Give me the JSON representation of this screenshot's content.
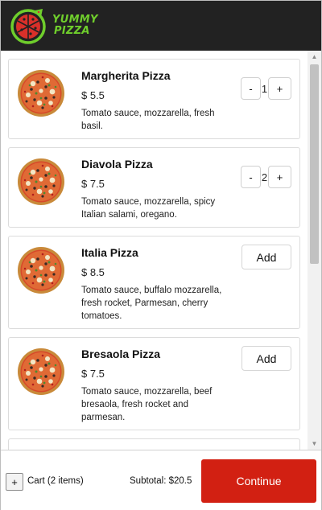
{
  "brand": {
    "line1": "YUMMY",
    "line2": "PIZZA",
    "accent": "#6fce2c",
    "header_bg": "#222222"
  },
  "pizzas": [
    {
      "name": "Margherita Pizza",
      "price": "$ 5.5",
      "description": "Tomato sauce, mozzarella, fresh basil.",
      "quantity": "1",
      "in_cart": true
    },
    {
      "name": "Diavola Pizza",
      "price": "$ 7.5",
      "description": "Tomato sauce, mozzarella, spicy Italian salami, oregano.",
      "quantity": "2",
      "in_cart": true
    },
    {
      "name": "Italia Pizza",
      "price": "$ 8.5",
      "description": "Tomato sauce, buffalo mozzarella, fresh rocket, Parmesan, cherry tomatoes.",
      "add_label": "Add",
      "in_cart": false
    },
    {
      "name": "Bresaola Pizza",
      "price": "$ 7.5",
      "description": "Tomato sauce, mozzarella, beef bresaola, fresh rocket and parmesan.",
      "add_label": "Add",
      "in_cart": false
    }
  ],
  "stepper": {
    "minus": "-",
    "plus": "+"
  },
  "footer": {
    "cart_toggle": "+",
    "cart_label": "Cart (2 items)",
    "subtotal": "Subtotal: $20.5",
    "continue_label": "Continue",
    "continue_color": "#d22012"
  },
  "icons": {
    "logo": "pizza-logo-icon",
    "pizza": "pizza-image-icon",
    "scroll_up": "scroll-up-arrow-icon",
    "scroll_down": "scroll-down-arrow-icon"
  }
}
